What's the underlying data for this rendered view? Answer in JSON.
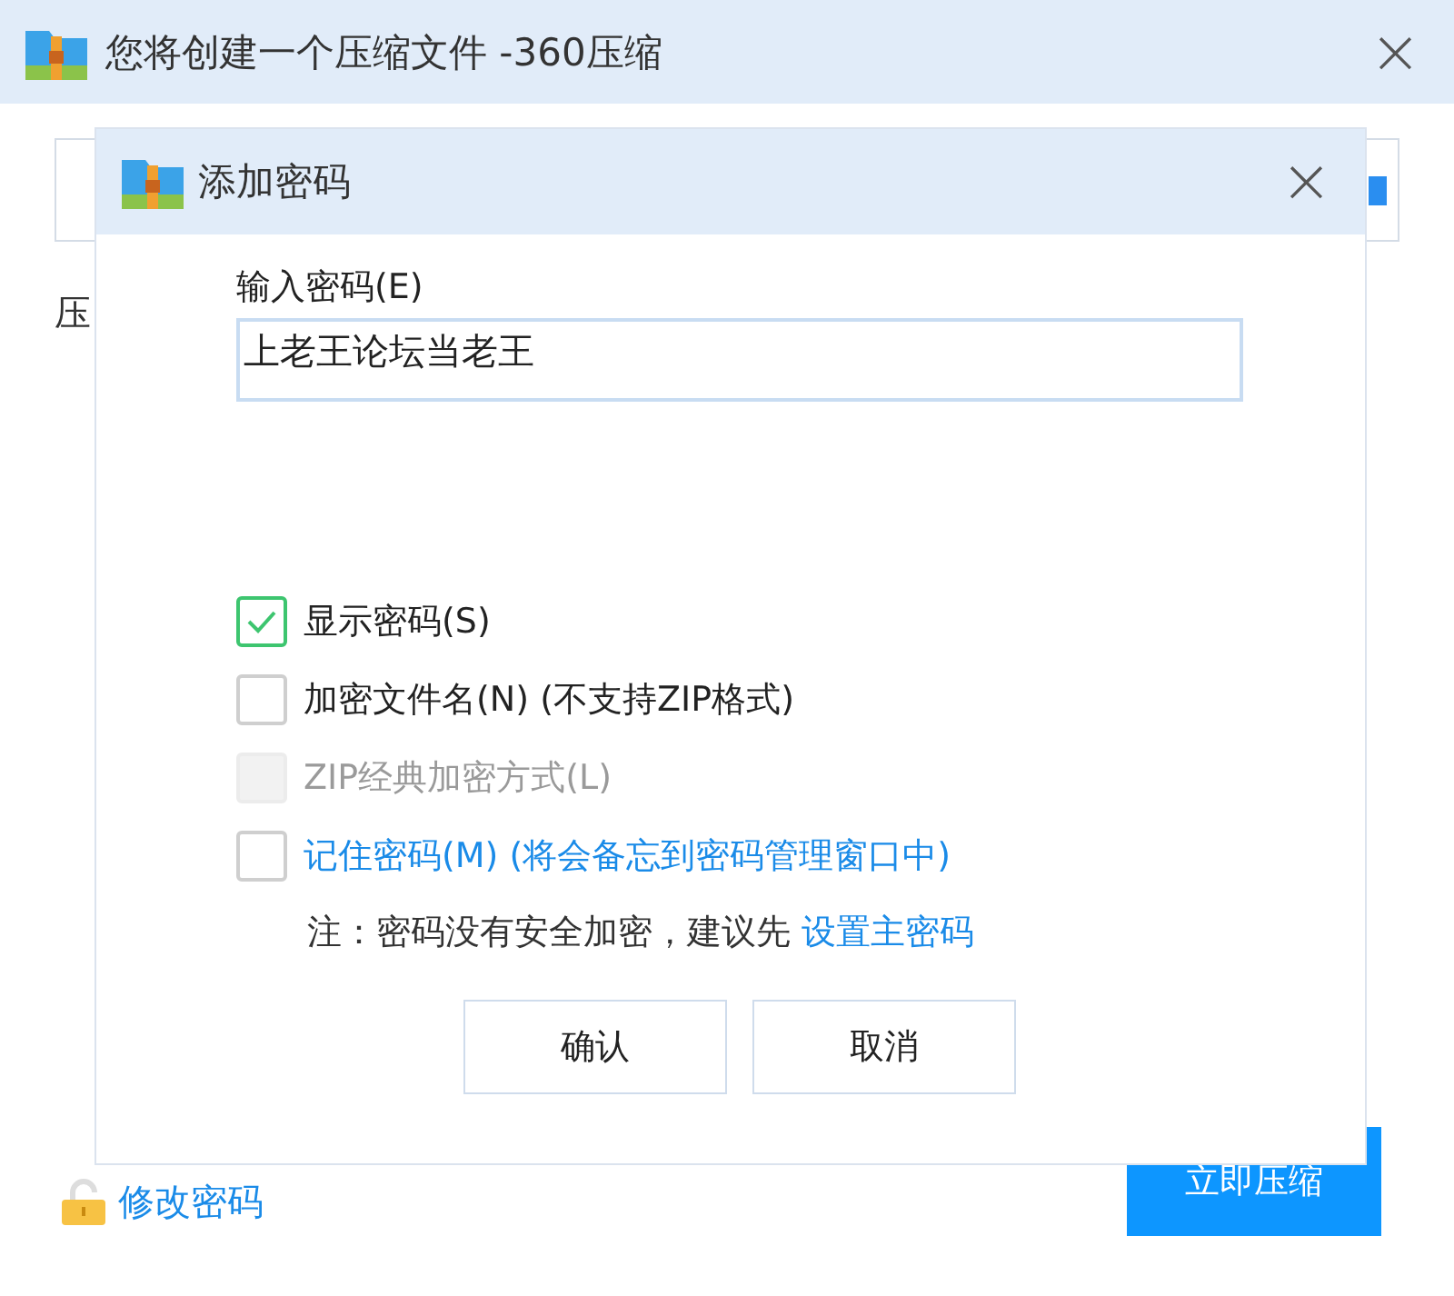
{
  "window": {
    "title": "您将创建一个压缩文件 -360压缩",
    "close": "×"
  },
  "background": {
    "label": "压",
    "change_password_link": "修改密码",
    "compress_button": "立即压缩"
  },
  "dialog": {
    "title": "添加密码",
    "close": "×",
    "password": {
      "label": "输入密码(E)",
      "value": "上老王论坛当老王"
    },
    "options": [
      {
        "label": "显示密码(S)",
        "checked": true,
        "disabled": false,
        "kind": "plain"
      },
      {
        "label": "加密文件名(N) (不支持ZIP格式)",
        "checked": false,
        "disabled": false,
        "kind": "plain"
      },
      {
        "label": "ZIP经典加密方式(L)",
        "checked": false,
        "disabled": true,
        "kind": "plain"
      },
      {
        "label": "记住密码(M) (将会备忘到密码管理窗口中)",
        "checked": false,
        "disabled": false,
        "kind": "link"
      }
    ],
    "note": {
      "text": "注：密码没有安全加密，建议先",
      "link": "设置主密码"
    },
    "buttons": [
      "确认",
      "取消"
    ]
  }
}
